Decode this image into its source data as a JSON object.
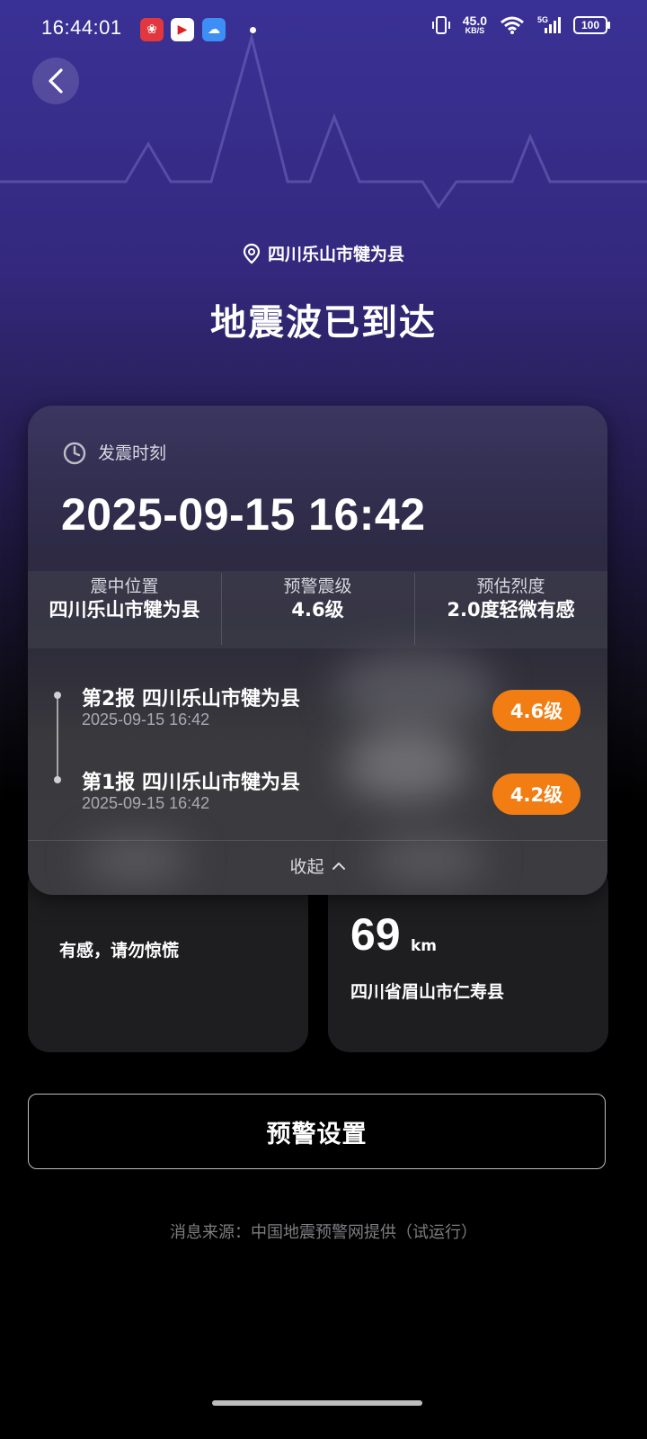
{
  "status_bar": {
    "time": "16:44:01",
    "net_speed_value": "45.0",
    "net_speed_unit": "KB/S",
    "network_type": "5G",
    "battery": "100"
  },
  "header": {
    "location": "四川乐山市犍为县",
    "title": "地震波已到达"
  },
  "quake_card": {
    "time_label": "发震时刻",
    "time_value": "2025-09-15 16:42",
    "info": [
      {
        "label": "震中位置",
        "value": "四川乐山市犍为县"
      },
      {
        "label": "预警震级",
        "value": "4.6级"
      },
      {
        "label": "预估烈度",
        "value": "2.0度轻微有感"
      }
    ],
    "reports": [
      {
        "title": "第2报 四川乐山市犍为县",
        "time": "2025-09-15 16:42",
        "magnitude": "4.6级"
      },
      {
        "title": "第1报 四川乐山市犍为县",
        "time": "2025-09-15 16:42",
        "magnitude": "4.2级"
      }
    ],
    "collapse_label": "收起"
  },
  "felt_card": {
    "text": "有感，请勿惊慌"
  },
  "distance_card": {
    "value": "69",
    "unit": "km",
    "place": "四川省眉山市仁寿县"
  },
  "settings_button": "预警设置",
  "source_text": "消息来源：中国地震预警网提供（试运行）",
  "colors": {
    "accent_orange": "#f27d12",
    "header_purple": "#3a3196"
  },
  "icons": [
    "back-icon",
    "location-pin-icon",
    "clock-icon",
    "chevron-up-icon",
    "wifi-icon",
    "signal-icon",
    "vibrate-icon",
    "battery-icon"
  ]
}
